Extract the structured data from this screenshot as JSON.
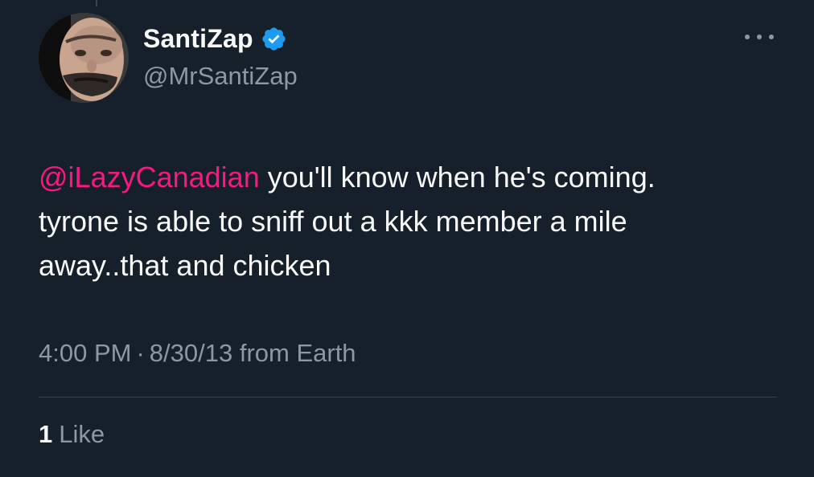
{
  "tweet": {
    "display_name": "SantiZap",
    "handle": "@MrSantiZap",
    "verified": true,
    "avatar_icon": "avatar-photo",
    "more_icon": "ellipsis-icon",
    "mention": "@iLazyCanadian",
    "text_line1_rest": " you'll know when he's coming.",
    "text_line2": "tyrone is able to sniff out a kkk member a mile",
    "text_line3": "away..that and chicken",
    "time": "4:00 PM",
    "separator": "·",
    "date": "8/30/13",
    "source": "from Earth",
    "like_count": "1",
    "like_label": "Like"
  },
  "colors": {
    "background": "#15202b",
    "text": "#f7f9f9",
    "secondary_text": "#8b98a5",
    "mention": "#f91880",
    "verified_badge": "#1d9bf0",
    "divider": "#38444d"
  }
}
